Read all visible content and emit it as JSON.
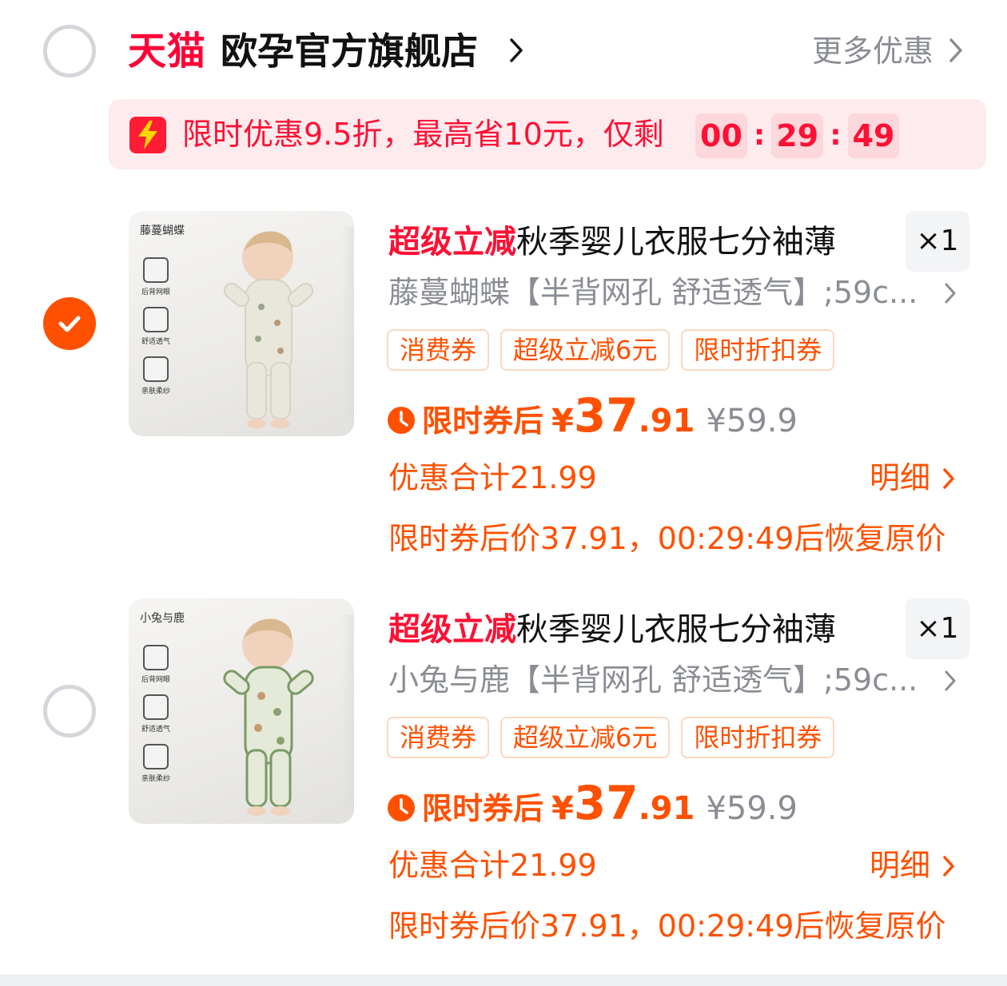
{
  "shop": {
    "platform": "天猫",
    "name": "欧孕官方旗舰店",
    "more_discount": "更多优惠",
    "selected": false
  },
  "promo": {
    "text": "限时优惠9.5折，最高省10元，仅剩",
    "timer": {
      "hours": "00",
      "minutes": "29",
      "seconds": "49"
    }
  },
  "products": [
    {
      "selected": true,
      "variant_tag": "藤蔓蝴蝶",
      "features": [
        "后背网眼",
        "舒适透气",
        "亲肤柔纱"
      ],
      "title_highlight": "超级立减",
      "title": "秋季婴儿衣服七分袖薄",
      "quantity": "×1",
      "sku": "藤蔓蝴蝶【半背网孔 舒适透气】;59c...",
      "tags": [
        "消费券",
        "超级立减6元",
        "限时折扣券"
      ],
      "price_label": "限时券后",
      "currency": "¥",
      "price_int": "37",
      "price_dec": ".91",
      "original_price": "¥59.9",
      "saving": "优惠合计21.99",
      "detail": "明细",
      "restore_note": "限时券后价37.91，00:29:49后恢复原价",
      "outfit_color": "#e9e6dc",
      "trim_color": "#e9e6dc"
    },
    {
      "selected": false,
      "variant_tag": "小兔与鹿",
      "features": [
        "后背网眼",
        "舒适透气",
        "亲肤柔纱"
      ],
      "title_highlight": "超级立减",
      "title": "秋季婴儿衣服七分袖薄",
      "quantity": "×1",
      "sku": "小兔与鹿【半背网孔 舒适透气】;59c...",
      "tags": [
        "消费券",
        "超级立减6元",
        "限时折扣券"
      ],
      "price_label": "限时券后",
      "currency": "¥",
      "price_int": "37",
      "price_dec": ".91",
      "original_price": "¥59.9",
      "saving": "优惠合计21.99",
      "detail": "明细",
      "restore_note": "限时券后价37.91，00:29:49后恢复原价",
      "outfit_color": "#e4e9d8",
      "trim_color": "#7a9a64"
    }
  ],
  "colors": {
    "brand_red": "#ff0036",
    "accent_orange": "#ff5000",
    "promo_bg": "#fdebee",
    "muted_text": "#8a8d93"
  }
}
